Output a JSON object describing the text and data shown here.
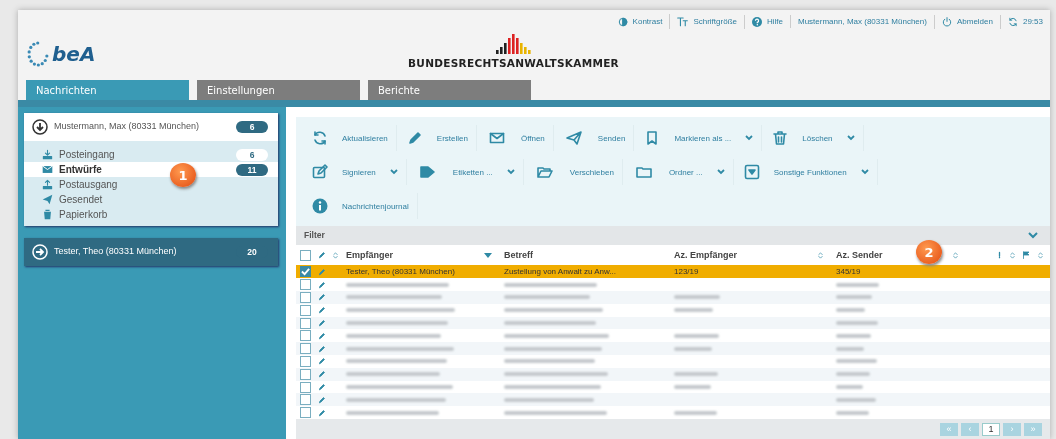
{
  "top_links": [
    {
      "label": "Kontrast"
    },
    {
      "label": "Schriftgröße"
    },
    {
      "label": "Hilfe"
    },
    {
      "label": "Mustermann, Max (80331 München)"
    },
    {
      "label": "Abmelden"
    },
    {
      "label": "29:53"
    }
  ],
  "brand": {
    "logo": "beA",
    "org": "BUNDESRECHTSANWALTSKAMMER"
  },
  "tabs": [
    {
      "label": "Nachrichten",
      "selected": true
    },
    {
      "label": "Einstellungen",
      "selected": false
    },
    {
      "label": "Berichte",
      "selected": false
    }
  ],
  "accounts": [
    {
      "name": "Mustermann, Max (80331 München)",
      "count": "6",
      "expanded": true,
      "folders": [
        {
          "label": "Posteingang",
          "count": "6",
          "selected": false
        },
        {
          "label": "Entwürfe",
          "count": "11",
          "selected": true
        },
        {
          "label": "Postausgang",
          "selected": false
        },
        {
          "label": "Gesendet",
          "selected": false
        },
        {
          "label": "Papierkorb",
          "selected": false
        }
      ]
    },
    {
      "name": "Tester, Theo (80331 München)",
      "count": "20",
      "expanded": false
    }
  ],
  "toolbar": [
    [
      {
        "label": "Aktualisieren",
        "dropdown": false
      },
      {
        "label": "Erstellen",
        "dropdown": false
      },
      {
        "label": "Öffnen",
        "dropdown": false
      },
      {
        "label": "Senden",
        "dropdown": false
      },
      {
        "label": "Markieren als ...",
        "dropdown": true
      },
      {
        "label": "Löschen",
        "dropdown": true
      }
    ],
    [
      {
        "label": "Signieren",
        "dropdown": true
      },
      {
        "label": "Etiketten ...",
        "dropdown": true
      },
      {
        "label": "Verschieben",
        "dropdown": false
      },
      {
        "label": "Ordner ...",
        "dropdown": true
      },
      {
        "label": "Sonstige Funktionen",
        "dropdown": true
      }
    ],
    [
      {
        "label": "Nachrichtenjournal",
        "dropdown": false
      }
    ]
  ],
  "filter": {
    "label": "Filter",
    "expanded": false
  },
  "table": {
    "select_all": {
      "checked": false
    },
    "columns": [
      "Empfänger",
      "Betreff",
      "Az. Empfänger",
      "Az. Sender"
    ],
    "rows": [
      {
        "cells": [
          "Tester, Theo (80331 München)",
          "Zustellung von Anwalt zu Anw...",
          "123/19",
          "345/19"
        ],
        "checked": true,
        "selected": true
      },
      {
        "redacted": true,
        "checked": false,
        "selected": false
      },
      {
        "redacted": true,
        "checked": false,
        "selected": false
      },
      {
        "redacted": true,
        "checked": false,
        "selected": false
      },
      {
        "redacted": true,
        "checked": false,
        "selected": false
      },
      {
        "redacted": true,
        "checked": false,
        "selected": false
      },
      {
        "redacted": true,
        "checked": false,
        "selected": false
      },
      {
        "redacted": true,
        "checked": false,
        "selected": false
      },
      {
        "redacted": true,
        "checked": false,
        "selected": false
      },
      {
        "redacted": true,
        "checked": false,
        "selected": false
      },
      {
        "redacted": true,
        "checked": false,
        "selected": false
      },
      {
        "redacted": true,
        "checked": false,
        "selected": false
      }
    ]
  },
  "pagination": [
    {
      "label": "«",
      "selected": false
    },
    {
      "label": "‹",
      "selected": false
    },
    {
      "label": "1",
      "selected": true
    },
    {
      "label": "›",
      "selected": false
    },
    {
      "label": "»",
      "selected": false
    }
  ],
  "callouts": [
    {
      "label": "1"
    },
    {
      "label": "2"
    }
  ]
}
